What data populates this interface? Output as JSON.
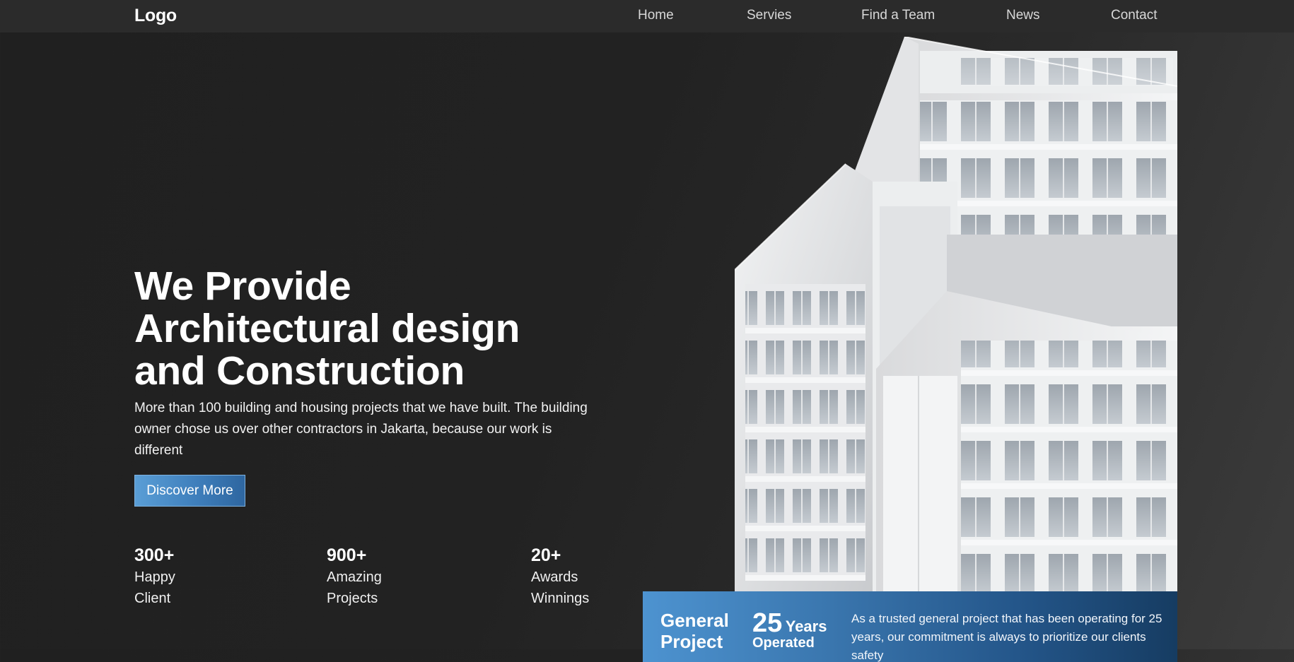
{
  "nav": {
    "logo": "Logo",
    "links": [
      "Home",
      "Servies",
      "Find a Team",
      "News",
      "Contact"
    ]
  },
  "hero": {
    "title_lines": [
      "We Provide",
      "Architectural design",
      "and Construction"
    ],
    "description": "More than 100 building and housing projects that we have built. The building owner chose us over other contractors in Jakarta, because our work is different",
    "cta_label": "Discover More"
  },
  "stats": [
    {
      "value": "300+",
      "label_lines": [
        "Happy",
        "Client"
      ]
    },
    {
      "value": "900+",
      "label_lines": [
        "Amazing",
        "Projects"
      ]
    },
    {
      "value": "20+",
      "label_lines": [
        "Awards",
        "Winnings"
      ]
    }
  ],
  "info_card": {
    "title": "General Project",
    "years_number": "25",
    "years_unit": "Years",
    "years_sub": "Operated",
    "description": "As a trusted general project that has been operating for 25 years, our commitment is always to prioritize our clients safety"
  },
  "colors": {
    "background": "#222222",
    "navbar": "#2b2b2b",
    "accent_blue": "#3f7fbc",
    "card_dark_blue": "#163c62"
  }
}
